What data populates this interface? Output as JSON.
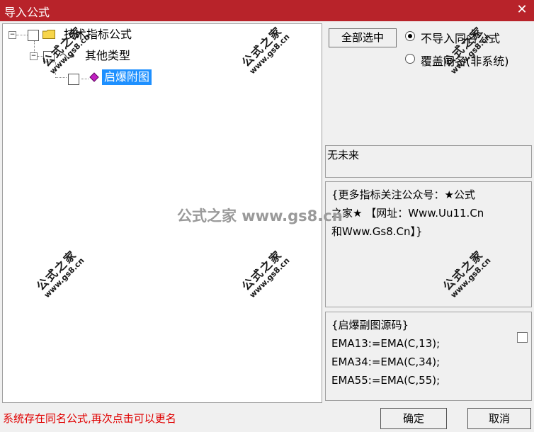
{
  "window": {
    "title": "导入公式",
    "close_glyph": "✕"
  },
  "tree": {
    "root": {
      "label": "技术指标公式",
      "expander": "−"
    },
    "child": {
      "label": "其他类型",
      "expander": "−"
    },
    "leaf": {
      "label": "启爆附图"
    }
  },
  "options": {
    "select_all_label": "全部选中",
    "radio_skip_label": "不导入同名公式",
    "radio_overwrite_label": "覆盖同名(非系统)",
    "selected_radio": "skip"
  },
  "author": {
    "text": "无未来"
  },
  "description": {
    "line1": "{更多指标关注公众号：★公式",
    "line2": "之家★ 【网址：Www.Uu11.Cn",
    "line3": "和Www.Gs8.Cn】}"
  },
  "source": {
    "line1": "{启爆副图源码}",
    "line2": "EMA13:=EMA(C,13);",
    "line3": "EMA34:=EMA(C,34);",
    "line4": "EMA55:=EMA(C,55);"
  },
  "status": {
    "message": "系统存在同名公式,再次点击可以更名"
  },
  "buttons": {
    "ok": "确定",
    "cancel": "取消"
  },
  "watermark": {
    "brand": "公式之家",
    "url": "www.gs8.cn",
    "center": "公式之家 www.gs8.cn"
  },
  "colors": {
    "titlebar": "#b8232a",
    "selection": "#1e90ff",
    "status": "#e00000"
  }
}
